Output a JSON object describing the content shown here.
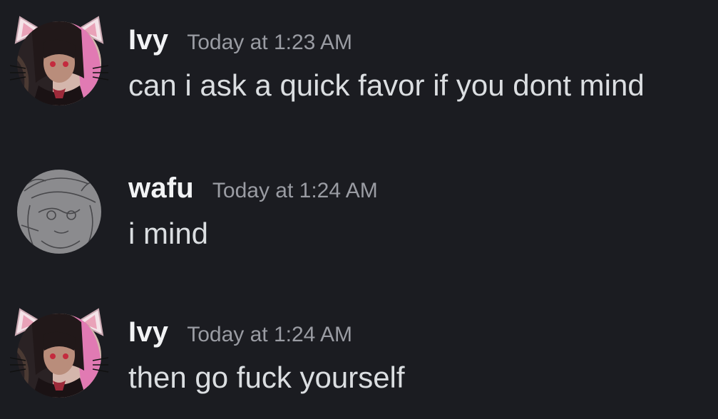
{
  "messages": [
    {
      "username": "Ivy",
      "timestamp": "Today at 1:23 AM",
      "content": "can i ask a quick favor if you dont mind",
      "avatar": "cat-ear-girl-avatar"
    },
    {
      "username": "wafu",
      "timestamp": "Today at 1:24 AM",
      "content": "i mind",
      "avatar": "sketch-avatar"
    },
    {
      "username": "Ivy",
      "timestamp": "Today at 1:24 AM",
      "content": "then go fuck yourself",
      "avatar": "cat-ear-girl-avatar"
    }
  ],
  "colors": {
    "background": "#1b1c21",
    "username": "#f2f3f5",
    "timestamp": "#9a9ca3",
    "message_text": "#dbdee1"
  }
}
